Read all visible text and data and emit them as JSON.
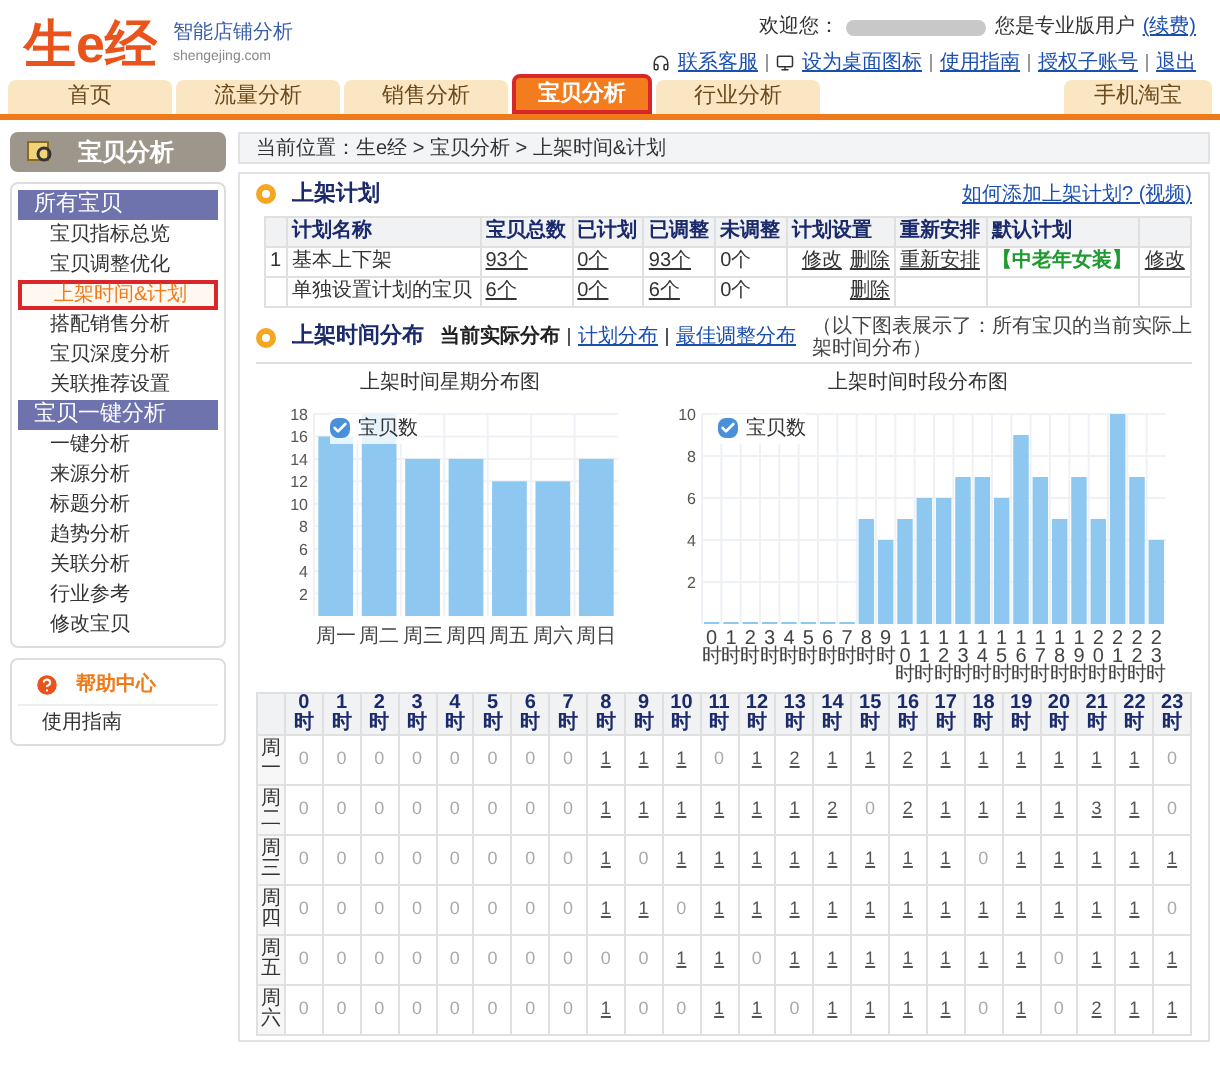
{
  "logo": {
    "name": "生e经",
    "slogan": "智能店铺分析",
    "domain": "shengejing.com"
  },
  "user_bar": {
    "greeting": "欢迎您：",
    "account_type": "您是专业版用户",
    "renew": "(续费)",
    "links": [
      "联系客服",
      "设为桌面图标",
      "使用指南",
      "授权子账号",
      "退出"
    ]
  },
  "tabs": [
    {
      "label": "首页",
      "selected": false
    },
    {
      "label": "流量分析",
      "selected": false
    },
    {
      "label": "销售分析",
      "selected": false
    },
    {
      "label": "宝贝分析",
      "selected": true
    },
    {
      "label": "行业分析",
      "selected": false
    }
  ],
  "right_tab": {
    "label": "手机淘宝"
  },
  "sidebar": {
    "title": "宝贝分析",
    "groups": [
      {
        "title": "所有宝贝",
        "items": [
          {
            "label": "宝贝指标总览",
            "selected": false
          },
          {
            "label": "宝贝调整优化",
            "selected": false
          },
          {
            "label": "上架时间&计划",
            "selected": true
          },
          {
            "label": "搭配销售分析",
            "selected": false
          },
          {
            "label": "宝贝深度分析",
            "selected": false
          },
          {
            "label": "关联推荐设置",
            "selected": false
          }
        ]
      },
      {
        "title": "宝贝一键分析",
        "items": [
          {
            "label": "一键分析",
            "selected": false
          },
          {
            "label": "来源分析",
            "selected": false
          },
          {
            "label": "标题分析",
            "selected": false
          },
          {
            "label": "趋势分析",
            "selected": false
          },
          {
            "label": "关联分析",
            "selected": false
          },
          {
            "label": "行业参考",
            "selected": false
          },
          {
            "label": "修改宝贝",
            "selected": false
          }
        ]
      }
    ],
    "help": {
      "title": "帮助中心",
      "items": [
        "使用指南"
      ]
    }
  },
  "breadcrumb": "当前位置：生e经 > 宝贝分析 > 上架时间&计划",
  "plan": {
    "title": "上架计划",
    "help_link": "如何添加上架计划? (视频)",
    "columns": [
      "",
      "计划名称",
      "宝贝总数",
      "已计划",
      "已调整",
      "未调整",
      "计划设置",
      "重新安排",
      "默认计划",
      ""
    ],
    "rows": [
      {
        "index": "1",
        "name": "基本上下架",
        "total": "93个",
        "planned": "0个",
        "adjusted": "93个",
        "unadjusted": "0个",
        "settings": [
          "修改",
          "删除"
        ],
        "rearrange": "重新安排",
        "default": "【中老年女装】",
        "action": "修改"
      },
      {
        "index": "",
        "name": "单独设置计划的宝贝",
        "total": "6个",
        "planned": "0个",
        "adjusted": "6个",
        "unadjusted": "0个",
        "settings": [
          "删除"
        ],
        "rearrange": "",
        "default": "",
        "action": ""
      }
    ]
  },
  "distribution": {
    "title": "上架时间分布",
    "views": [
      {
        "label": "当前实际分布",
        "selected": true
      },
      {
        "label": "计划分布",
        "selected": false
      },
      {
        "label": "最佳调整分布",
        "selected": false
      }
    ],
    "note": "（以下图表展示了：所有宝贝的当前实际上架时间分布）",
    "weekday_chart": {
      "title": "上架时间星期分布图",
      "legend_checked": true,
      "chart_data": {
        "type": "bar",
        "grid": true,
        "categories": [
          "周一",
          "周二",
          "周三",
          "周四",
          "周五",
          "周六",
          "周日"
        ],
        "series": [
          {
            "name": "宝贝数",
            "color": "#8ec8f0",
            "values": [
              16,
              18,
              14,
              14,
              12,
              12,
              14
            ]
          }
        ],
        "ylim": [
          0,
          18
        ],
        "yticks": [
          2,
          4,
          6,
          8,
          10,
          12,
          14,
          16,
          18
        ]
      }
    },
    "hour_chart": {
      "title": "上架时间时段分布图",
      "legend_checked": true,
      "chart_data": {
        "type": "bar",
        "grid": true,
        "categories": [
          "0时",
          "1时",
          "2时",
          "3时",
          "4时",
          "5时",
          "6时",
          "7时",
          "8时",
          "9时",
          "10时",
          "11时",
          "12时",
          "13时",
          "14时",
          "15时",
          "16时",
          "17时",
          "18时",
          "19时",
          "20时",
          "21时",
          "22时",
          "23时"
        ],
        "series": [
          {
            "name": "宝贝数",
            "color": "#8ec8f0",
            "values": [
              0,
              0,
              0,
              0,
              0,
              0,
              0,
              0,
              5,
              4,
              5,
              6,
              6,
              7,
              7,
              6,
              9,
              7,
              5,
              7,
              5,
              10,
              7,
              4
            ]
          }
        ],
        "ylim": [
          0,
          10
        ],
        "yticks": [
          2,
          4,
          6,
          8,
          10
        ]
      }
    }
  },
  "grid": {
    "hours": [
      "0时",
      "1时",
      "2时",
      "3时",
      "4时",
      "5时",
      "6时",
      "7时",
      "8时",
      "9时",
      "10时",
      "11时",
      "12时",
      "13时",
      "14时",
      "15时",
      "16时",
      "17时",
      "18时",
      "19时",
      "20时",
      "21时",
      "22时",
      "23时"
    ],
    "rows": [
      {
        "day": "周一",
        "cells": [
          "0",
          "0",
          "0",
          "0",
          "0",
          "0",
          "0",
          "0",
          "1",
          "1",
          "1",
          "0",
          "1",
          "2",
          "1",
          "1",
          "2",
          "1",
          "1",
          "1",
          "1",
          "1",
          "1",
          "0"
        ]
      },
      {
        "day": "周二",
        "cells": [
          "0",
          "0",
          "0",
          "0",
          "0",
          "0",
          "0",
          "0",
          "1",
          "1",
          "1",
          "1",
          "1",
          "1",
          "2",
          "0",
          "2",
          "1",
          "1",
          "1",
          "1",
          "3",
          "1",
          "0"
        ]
      },
      {
        "day": "周三",
        "cells": [
          "0",
          "0",
          "0",
          "0",
          "0",
          "0",
          "0",
          "0",
          "1",
          "0",
          "1",
          "1",
          "1",
          "1",
          "1",
          "1",
          "1",
          "1",
          "0",
          "1",
          "1",
          "1",
          "1",
          "1"
        ]
      },
      {
        "day": "周四",
        "cells": [
          "0",
          "0",
          "0",
          "0",
          "0",
          "0",
          "0",
          "0",
          "1",
          "1",
          "0",
          "1",
          "1",
          "1",
          "1",
          "1",
          "1",
          "1",
          "1",
          "1",
          "1",
          "1",
          "1",
          "0"
        ]
      },
      {
        "day": "周五",
        "cells": [
          "0",
          "0",
          "0",
          "0",
          "0",
          "0",
          "0",
          "0",
          "0",
          "0",
          "1",
          "1",
          "0",
          "1",
          "1",
          "1",
          "1",
          "1",
          "1",
          "1",
          "0",
          "1",
          "1",
          "1"
        ]
      },
      {
        "day": "周六",
        "cells": [
          "0",
          "0",
          "0",
          "0",
          "0",
          "0",
          "0",
          "0",
          "1",
          "0",
          "0",
          "1",
          "1",
          "0",
          "1",
          "1",
          "1",
          "1",
          "0",
          "1",
          "0",
          "2",
          "1",
          "1"
        ]
      }
    ]
  }
}
